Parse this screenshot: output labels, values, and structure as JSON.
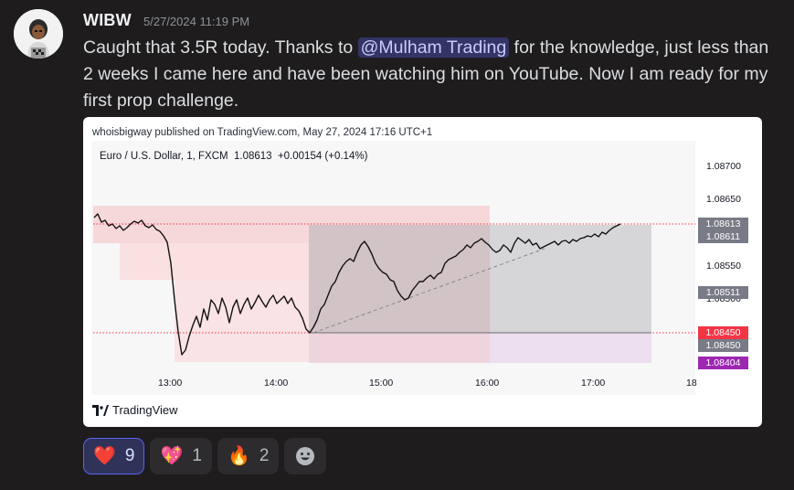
{
  "author": {
    "username": "WIBW",
    "timestamp": "5/27/2024 11:19 PM"
  },
  "message": {
    "before_mention": "Caught that 3.5R today. Thanks to ",
    "mention": "@Mulham Trading",
    "after_mention": " for the knowledge, just less than 2 weeks I came here and have been watching him on YouTube. Now I am ready for my first prop challenge."
  },
  "embed": {
    "publisher_line": "whoisbigway published on TradingView.com, May 27, 2024 17:16 UTC+1",
    "symbol_line": "Euro / U.S. Dollar, 1, FXCM  1.08613  +0.00154 (+0.14%)",
    "brand": "TradingView",
    "price_scale": [
      "1.08700",
      "1.08650",
      "1.08550",
      "1.08500"
    ],
    "price_tags": [
      {
        "label": "1.08613",
        "color": "#787b86"
      },
      {
        "label": "1.08611",
        "color": "#787b86"
      },
      {
        "label": "1.08511",
        "color": "#787b86"
      },
      {
        "label": "1.08450",
        "color": "#f23645"
      },
      {
        "label": "1.08450",
        "color": "#787b86"
      },
      {
        "label": "1.08404",
        "color": "#9c27b0"
      }
    ],
    "time_axis": [
      "13:00",
      "14:00",
      "15:00",
      "16:00",
      "17:00",
      "18"
    ]
  },
  "reactions": [
    {
      "emoji": "❤️",
      "count": "9",
      "active": true,
      "icon": "red-heart-icon"
    },
    {
      "emoji": "💖",
      "count": "1",
      "active": false,
      "icon": "sparkling-heart-icon"
    },
    {
      "emoji": "🔥",
      "count": "2",
      "active": false,
      "icon": "fire-icon"
    }
  ],
  "add_reaction_icon": "add-reaction-smiley-icon"
}
